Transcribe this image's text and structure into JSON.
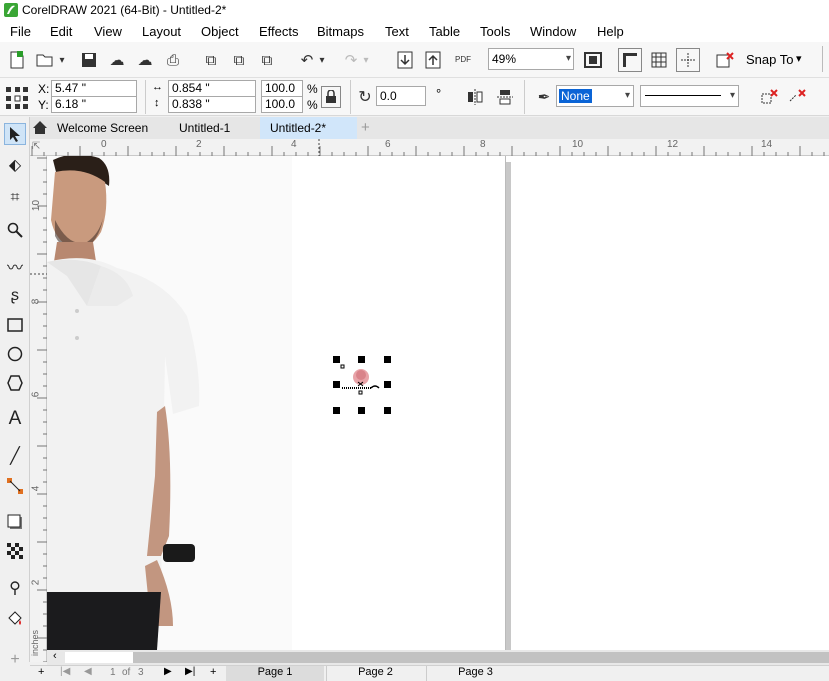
{
  "window": {
    "title": "CorelDRAW 2021 (64-Bit) - Untitled-2*"
  },
  "menu": [
    "File",
    "Edit",
    "View",
    "Layout",
    "Object",
    "Effects",
    "Bitmaps",
    "Text",
    "Table",
    "Tools",
    "Window",
    "Help"
  ],
  "toolbar": {
    "zoom_value": "49%",
    "snap_label": "Snap To",
    "pdf_label": "PDF"
  },
  "properties": {
    "x_label": "X:",
    "y_label": "Y:",
    "x_value": "5.47 \"",
    "y_value": "6.18 \"",
    "width_value": "0.854 \"",
    "height_value": "0.838 \"",
    "scale_w": "100.0",
    "scale_h": "100.0",
    "percent_1": "%",
    "percent_2": "%",
    "rotation_value": "0.0",
    "degree_symbol": "°",
    "outline_width": "None"
  },
  "doc_tabs": [
    "Welcome Screen",
    "Untitled-1",
    "Untitled-2*"
  ],
  "ruler": {
    "h_ticks": [
      "0",
      "2",
      "4",
      "6",
      "8",
      "10",
      "12",
      "14"
    ],
    "v_ticks": [
      "10",
      "8",
      "6",
      "4",
      "2"
    ],
    "unit": "inches"
  },
  "page_nav": {
    "current": "1",
    "of_label": "of",
    "total": "3",
    "pages": [
      "Page 1",
      "Page 2",
      "Page 3"
    ]
  }
}
